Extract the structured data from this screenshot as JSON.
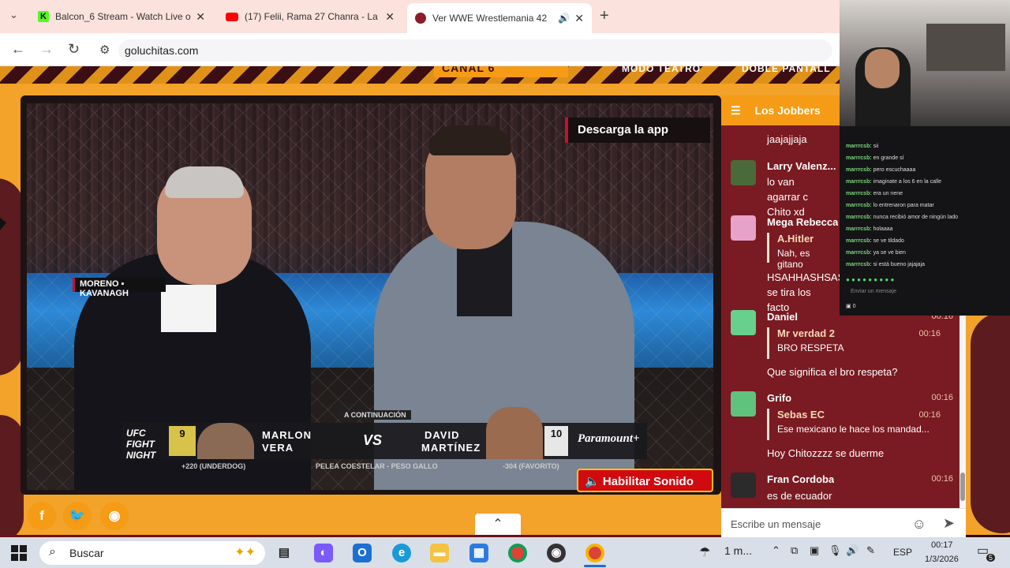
{
  "browser": {
    "tabs": [
      {
        "title": "Balcon_6 Stream - Watch Live o",
        "icon": "kick-icon"
      },
      {
        "title": "(17) Felii, Rama 27 Chanra - La",
        "icon": "youtube-icon"
      },
      {
        "title": "Ver WWE Wrestlemania 42",
        "icon": "site-icon"
      }
    ],
    "url": "goluchitas.com"
  },
  "site": {
    "header_items": [
      "CANAL 6",
      "MODO TEATRO",
      "DOBLE PANTALL"
    ]
  },
  "video": {
    "download_app": "Descarga la app",
    "nameplate": "MORENO ▪ KAVANAGH",
    "lower_third": {
      "next_label": "A CONTINUACIÓN",
      "brand": "UFC FIGHT NIGHT",
      "fighter1_rank": "9",
      "fighter1_name_line1": "MARLON",
      "fighter1_name_line2": "VERA",
      "fighter1_odds": "+220 (UNDERDOG)",
      "vs": "VS",
      "fighter2_rank": "10",
      "fighter2_name_line1": "DAVID",
      "fighter2_name_line2": "MARTÍNEZ",
      "fighter2_odds": "-304 (FAVORITO)",
      "bout": "PELEA COESTELAR - PESO GALLO",
      "network": "Paramount+"
    },
    "enable_sound": "Habilitar Sonido"
  },
  "chat": {
    "title": "Los Jobbers",
    "messages": [
      {
        "user": "",
        "text": "jaajajjaja",
        "time": ""
      },
      {
        "user": "Larry Valenz...",
        "text": "lo van agarrar c Chito xd",
        "time": ""
      },
      {
        "user": "Mega Rebecca",
        "quote_user": "A.Hitler",
        "quote_text": "Nah, es gitano",
        "text": "HSAHHASHSAS se tira los facto",
        "time": ""
      },
      {
        "user": "Daniel",
        "quote_user": "Mr verdad 2",
        "quote_time": "00:16",
        "quote_text": "BRO RESPETA",
        "text": "Que significa el bro respeta?",
        "time": "00:16"
      },
      {
        "user": "Grifo",
        "quote_user": "Sebas EC",
        "quote_time": "00:16",
        "quote_text": "Ese mexicano le hace los mandad...",
        "text": "Hoy Chitozzzz se duerme",
        "time": "00:16"
      },
      {
        "user": "Fran Cordoba",
        "text": "es de ecuador",
        "time": "00:16"
      }
    ],
    "input_placeholder": "Escribe un mensaje"
  },
  "stream_chat": {
    "lines": [
      {
        "user": "marrrcsb:",
        "text": "sii"
      },
      {
        "user": "marrrcsb:",
        "text": "en grande sí"
      },
      {
        "user": "marrrcsb:",
        "text": "pero escuchaaaa"
      },
      {
        "user": "marrrcsb:",
        "text": "imaginate a los 6 en la calle"
      },
      {
        "user": "marrrcsb:",
        "text": "era un nene"
      },
      {
        "user": "marrrcsb:",
        "text": "lo entrenaron para matar"
      },
      {
        "user": "marrrcsb:",
        "text": "nunca recibió amor de ningún lado"
      },
      {
        "user": "marrrcsb:",
        "text": "holaaaa"
      },
      {
        "user": "marrrcsb:",
        "text": "se ve tildado"
      },
      {
        "user": "marrrcsb:",
        "text": "ya se ve bien"
      },
      {
        "user": "marrrcsb:",
        "text": "si está bueno jajajaja"
      }
    ],
    "input_placeholder": "Enviar un mensaje",
    "viewer_count": "0"
  },
  "taskbar": {
    "search_label": "Buscar",
    "weather": "1 m...",
    "language": "ESP",
    "time": "00:17",
    "date": "1/3/2026",
    "notifications": "5"
  },
  "colors": {
    "site_orange": "#f3a22a",
    "site_maroon": "#7a1a22",
    "accent_red": "#d10a10"
  }
}
